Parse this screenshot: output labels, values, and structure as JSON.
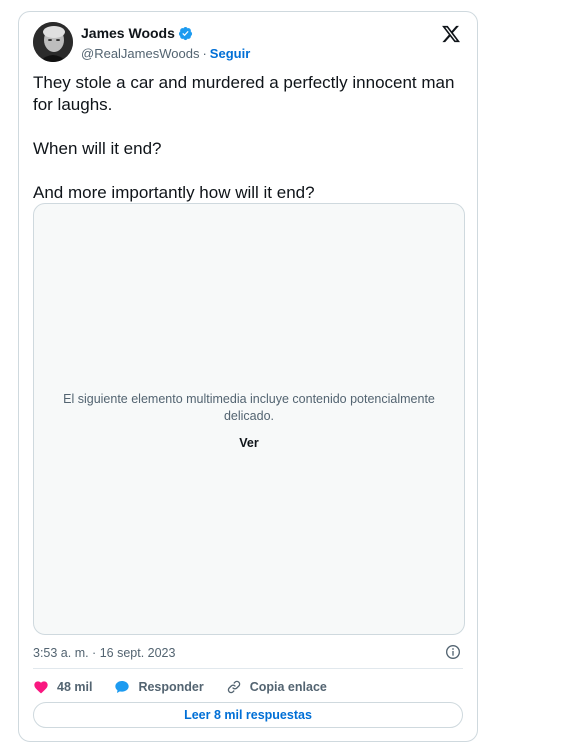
{
  "author": {
    "name": "James Woods",
    "handle": "@RealJamesWoods",
    "separator": "·",
    "follow_label": "Seguir"
  },
  "tweet": {
    "paragraphs": [
      "They stole a car and murdered a perfectly innocent man for laughs.",
      "When will it end?",
      "And more importantly how will it end?"
    ]
  },
  "media": {
    "warning_text": "El siguiente elemento multimedia incluye contenido potencialmente delicado.",
    "view_label": "Ver"
  },
  "meta": {
    "timestamp": "3:53 a. m. · 16 sept. 2023"
  },
  "actions": {
    "likes_count": "48 mil",
    "reply_label": "Responder",
    "copy_link_label": "Copia enlace"
  },
  "read_replies_label": "Leer 8 mil respuestas",
  "icons": {
    "verified": "verified-badge-icon",
    "logo": "x-logo-icon",
    "info": "info-icon",
    "like": "heart-icon",
    "reply": "speech-bubble-icon",
    "link": "link-icon"
  },
  "colors": {
    "link_blue": "#006fd6",
    "verified_blue": "#1d9bf0",
    "like_pink": "#f91880",
    "secondary_text": "#536471",
    "border": "#cfd9de"
  }
}
